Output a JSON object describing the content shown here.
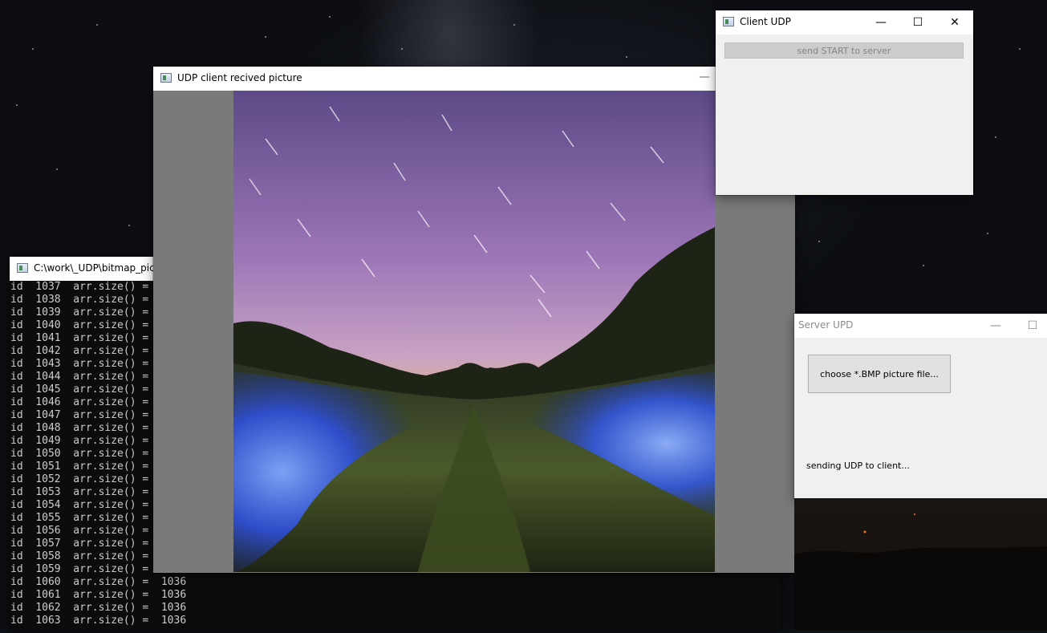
{
  "console_window": {
    "title": "C:\\work\\_UDP\\bitmap_pictu",
    "lines": [
      "id  1037  arr.size() =",
      "id  1038  arr.size() =",
      "id  1039  arr.size() =",
      "id  1040  arr.size() =",
      "id  1041  arr.size() =",
      "id  1042  arr.size() =",
      "id  1043  arr.size() =",
      "id  1044  arr.size() =",
      "id  1045  arr.size() =",
      "id  1046  arr.size() =",
      "id  1047  arr.size() =",
      "id  1048  arr.size() =",
      "id  1049  arr.size() =",
      "id  1050  arr.size() =",
      "id  1051  arr.size() =",
      "id  1052  arr.size() =",
      "id  1053  arr.size() =",
      "id  1054  arr.size() =",
      "id  1055  arr.size() =",
      "id  1056  arr.size() =",
      "id  1057  arr.size() =",
      "id  1058  arr.size() =",
      "id  1059  arr.size() =",
      "id  1060  arr.size() =  1036",
      "id  1061  arr.size() =  1036",
      "id  1062  arr.size() =  1036",
      "id  1063  arr.size() =  1036"
    ]
  },
  "picture_window": {
    "title": "UDP client recived picture",
    "minimize_glyph": "—"
  },
  "client_window": {
    "title": "Client UDP",
    "minimize_glyph": "—",
    "maximize_glyph": "☐",
    "close_glyph": "✕",
    "start_button_label": "send START to server"
  },
  "server_window": {
    "title": "Server UPD",
    "minimize_glyph": "—",
    "maximize_glyph": "☐",
    "choose_button_label": "choose *.BMP picture file...",
    "status_text": "sending UDP to client..."
  },
  "colors": {
    "console_bg": "#0c0c0c",
    "console_text": "#cccccc",
    "picture_frame": "#7a7a7a",
    "window_bg": "#f0f0f0"
  }
}
